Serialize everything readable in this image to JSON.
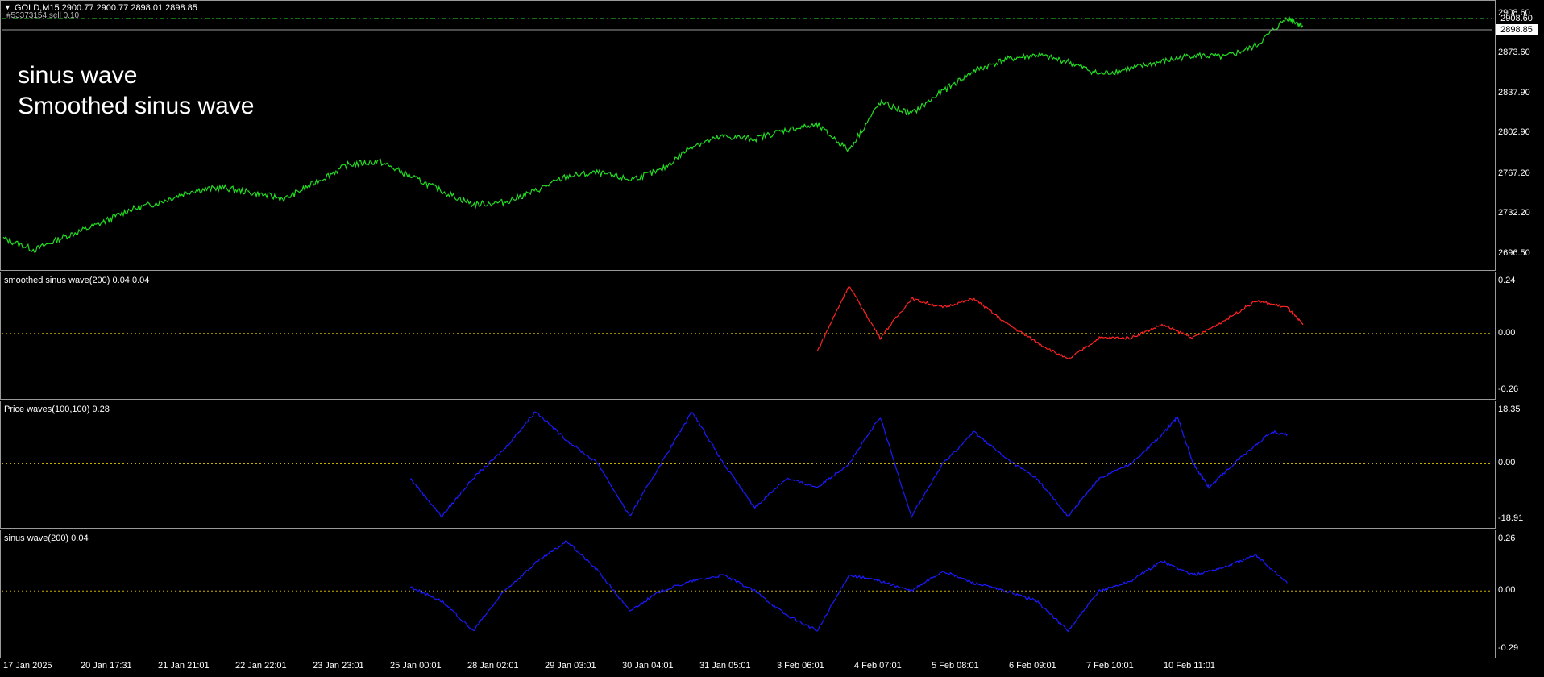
{
  "header": {
    "symbol_line": "GOLD,M15  2900.77 2900.77 2898.01 2898.85",
    "sub_line": "#53373154 sell 0.10"
  },
  "overlay": {
    "line1": "sinus wave",
    "line2": "Smoothed sinus wave"
  },
  "price_tags": {
    "high": "2908.60",
    "current": "2898.85"
  },
  "colors": {
    "price": "#22dd22",
    "smoothed": "#ff2222",
    "waves": "#1a1aff",
    "zero_line": "#c9b100",
    "grid_border": "#9a9a9a"
  },
  "panes": {
    "price": {
      "label": "",
      "ticks": [
        "2908.60",
        "2873.60",
        "2837.90",
        "2802.90",
        "2767.20",
        "2732.20",
        "2696.50"
      ]
    },
    "smoothed": {
      "label": "smoothed sinus wave(200) 0.04 0.04",
      "ticks": [
        "0.24",
        "0.00",
        "-0.26"
      ]
    },
    "price_waves": {
      "label": "Price waves(100,100) 9.28",
      "ticks": [
        "18.35",
        "0.00",
        "-18.91"
      ]
    },
    "sinus": {
      "label": "sinus wave(200) 0.04",
      "ticks": [
        "0.26",
        "0.00",
        "-0.29"
      ]
    }
  },
  "x_ticks": [
    "17 Jan 2025",
    "20 Jan 17:31",
    "21 Jan 21:01",
    "22 Jan 22:01",
    "23 Jan 23:01",
    "25 Jan 00:01",
    "28 Jan 02:01",
    "29 Jan 03:01",
    "30 Jan 04:01",
    "31 Jan 05:01",
    "3 Feb 06:01",
    "4 Feb 07:01",
    "5 Feb 08:01",
    "6 Feb 09:01",
    "7 Feb 10:01",
    "10 Feb 11:01"
  ],
  "chart_data": [
    {
      "type": "line",
      "title": "GOLD,M15",
      "ylim": [
        2690,
        2912
      ],
      "series": [
        {
          "name": "GOLD",
          "points": [
            [
              0,
              2710
            ],
            [
              2,
              2700
            ],
            [
              4,
              2712
            ],
            [
              6,
              2722
            ],
            [
              8,
              2735
            ],
            [
              10,
              2742
            ],
            [
              12,
              2752
            ],
            [
              14,
              2755
            ],
            [
              16,
              2750
            ],
            [
              18,
              2745
            ],
            [
              20,
              2760
            ],
            [
              22,
              2775
            ],
            [
              24,
              2778
            ],
            [
              26,
              2765
            ],
            [
              28,
              2752
            ],
            [
              30,
              2740
            ],
            [
              32,
              2742
            ],
            [
              34,
              2752
            ],
            [
              36,
              2765
            ],
            [
              38,
              2768
            ],
            [
              40,
              2762
            ],
            [
              42,
              2770
            ],
            [
              44,
              2792
            ],
            [
              46,
              2800
            ],
            [
              48,
              2798
            ],
            [
              50,
              2806
            ],
            [
              52,
              2810
            ],
            [
              54,
              2788
            ],
            [
              56,
              2830
            ],
            [
              58,
              2820
            ],
            [
              60,
              2840
            ],
            [
              62,
              2858
            ],
            [
              64,
              2868
            ],
            [
              66,
              2872
            ],
            [
              68,
              2866
            ],
            [
              70,
              2855
            ],
            [
              72,
              2860
            ],
            [
              74,
              2866
            ],
            [
              76,
              2872
            ],
            [
              78,
              2870
            ],
            [
              80,
              2880
            ],
            [
              82,
              2905
            ],
            [
              83,
              2898
            ]
          ]
        }
      ]
    },
    {
      "type": "line",
      "title": "smoothed sinus wave(200) 0.04 0.04",
      "ylim": [
        -0.26,
        0.24
      ],
      "series": [
        {
          "name": "smoothed sinus wave",
          "points": [
            [
              52,
              -0.08
            ],
            [
              54,
              0.22
            ],
            [
              56,
              -0.02
            ],
            [
              58,
              0.16
            ],
            [
              60,
              0.12
            ],
            [
              62,
              0.16
            ],
            [
              64,
              0.05
            ],
            [
              66,
              -0.04
            ],
            [
              68,
              -0.12
            ],
            [
              70,
              -0.02
            ],
            [
              72,
              -0.02
            ],
            [
              74,
              0.04
            ],
            [
              76,
              -0.02
            ],
            [
              78,
              0.06
            ],
            [
              80,
              0.15
            ],
            [
              82,
              0.12
            ],
            [
              83,
              0.04
            ]
          ]
        }
      ]
    },
    {
      "type": "line",
      "title": "Price waves(100,100) 9.28",
      "ylim": [
        -18.91,
        18.35
      ],
      "series": [
        {
          "name": "Price waves",
          "points": [
            [
              26,
              -5
            ],
            [
              28,
              -18
            ],
            [
              30,
              -5
            ],
            [
              32,
              5
            ],
            [
              34,
              18
            ],
            [
              36,
              8
            ],
            [
              38,
              0
            ],
            [
              40,
              -18
            ],
            [
              42,
              0
            ],
            [
              44,
              18
            ],
            [
              46,
              0
            ],
            [
              48,
              -15
            ],
            [
              50,
              -5
            ],
            [
              52,
              -8
            ],
            [
              54,
              0
            ],
            [
              56,
              16
            ],
            [
              58,
              -18
            ],
            [
              60,
              0
            ],
            [
              62,
              11
            ],
            [
              64,
              2
            ],
            [
              66,
              -5
            ],
            [
              68,
              -18
            ],
            [
              70,
              -5
            ],
            [
              72,
              0
            ],
            [
              74,
              10
            ],
            [
              75,
              16
            ],
            [
              76,
              0
            ],
            [
              77,
              -8
            ],
            [
              79,
              2
            ],
            [
              81,
              11
            ],
            [
              82,
              10
            ]
          ]
        }
      ]
    },
    {
      "type": "line",
      "title": "sinus wave(200) 0.04",
      "ylim": [
        -0.29,
        0.26
      ],
      "series": [
        {
          "name": "sinus wave",
          "points": [
            [
              26,
              0.02
            ],
            [
              28,
              -0.05
            ],
            [
              30,
              -0.2
            ],
            [
              32,
              0.0
            ],
            [
              34,
              0.14
            ],
            [
              36,
              0.25
            ],
            [
              38,
              0.1
            ],
            [
              40,
              -0.1
            ],
            [
              42,
              0.0
            ],
            [
              44,
              0.05
            ],
            [
              46,
              0.08
            ],
            [
              48,
              0.0
            ],
            [
              50,
              -0.12
            ],
            [
              52,
              -0.2
            ],
            [
              54,
              0.08
            ],
            [
              56,
              0.05
            ],
            [
              58,
              0.0
            ],
            [
              60,
              0.1
            ],
            [
              62,
              0.04
            ],
            [
              64,
              0.0
            ],
            [
              66,
              -0.05
            ],
            [
              68,
              -0.2
            ],
            [
              70,
              0.0
            ],
            [
              72,
              0.05
            ],
            [
              74,
              0.15
            ],
            [
              76,
              0.08
            ],
            [
              78,
              0.12
            ],
            [
              80,
              0.18
            ],
            [
              82,
              0.04
            ]
          ]
        }
      ]
    }
  ]
}
